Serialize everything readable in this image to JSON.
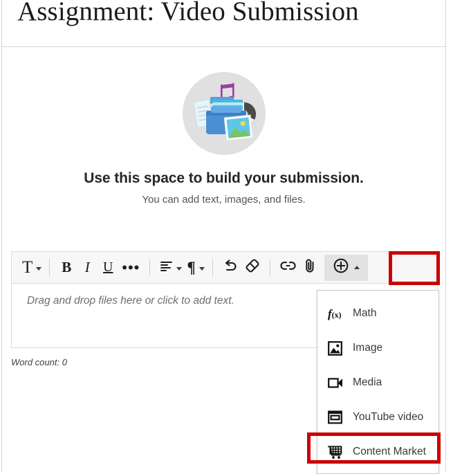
{
  "header": {
    "title": "Assignment: Video Submission"
  },
  "hero": {
    "art_icon": "submission-box-illustration",
    "heading": "Use this space to build your submission.",
    "subheading": "You can add text, images, and files."
  },
  "toolbar": {
    "items": [
      {
        "name": "text-style",
        "glyph": "T",
        "caret": "down"
      },
      {
        "name": "bold",
        "glyph": "B",
        "caret": "none"
      },
      {
        "name": "italic",
        "glyph": "I",
        "caret": "none"
      },
      {
        "name": "underline",
        "glyph": "U",
        "caret": "none"
      },
      {
        "name": "more-options",
        "glyph": "•••",
        "caret": "none"
      },
      {
        "name": "align",
        "glyph": "align-left-icon",
        "caret": "down"
      },
      {
        "name": "paragraph",
        "glyph": "¶",
        "caret": "down"
      },
      {
        "name": "undo",
        "glyph": "undo-icon",
        "caret": "none"
      },
      {
        "name": "eraser",
        "glyph": "eraser-icon",
        "caret": "none"
      },
      {
        "name": "link",
        "glyph": "link-icon",
        "caret": "none"
      },
      {
        "name": "attach",
        "glyph": "paperclip-icon",
        "caret": "none"
      },
      {
        "name": "add-content",
        "glyph": "plus-circle-icon",
        "caret": "up"
      }
    ]
  },
  "editor": {
    "placeholder": "Drag and drop files here or click to add text.",
    "word_count": "Word count: 0"
  },
  "dropdown": {
    "items": [
      {
        "icon": "math-function-icon",
        "label": "Math"
      },
      {
        "icon": "image-icon",
        "label": "Image"
      },
      {
        "icon": "media-video-icon",
        "label": "Media"
      },
      {
        "icon": "youtube-window-icon",
        "label": "YouTube video"
      },
      {
        "icon": "shopping-cart-icon",
        "label": "Content Market"
      }
    ]
  },
  "highlights": {
    "color": "#cc0000",
    "add-content-button": "add-content-button-highlight",
    "content-market": "content-market-highlight"
  }
}
